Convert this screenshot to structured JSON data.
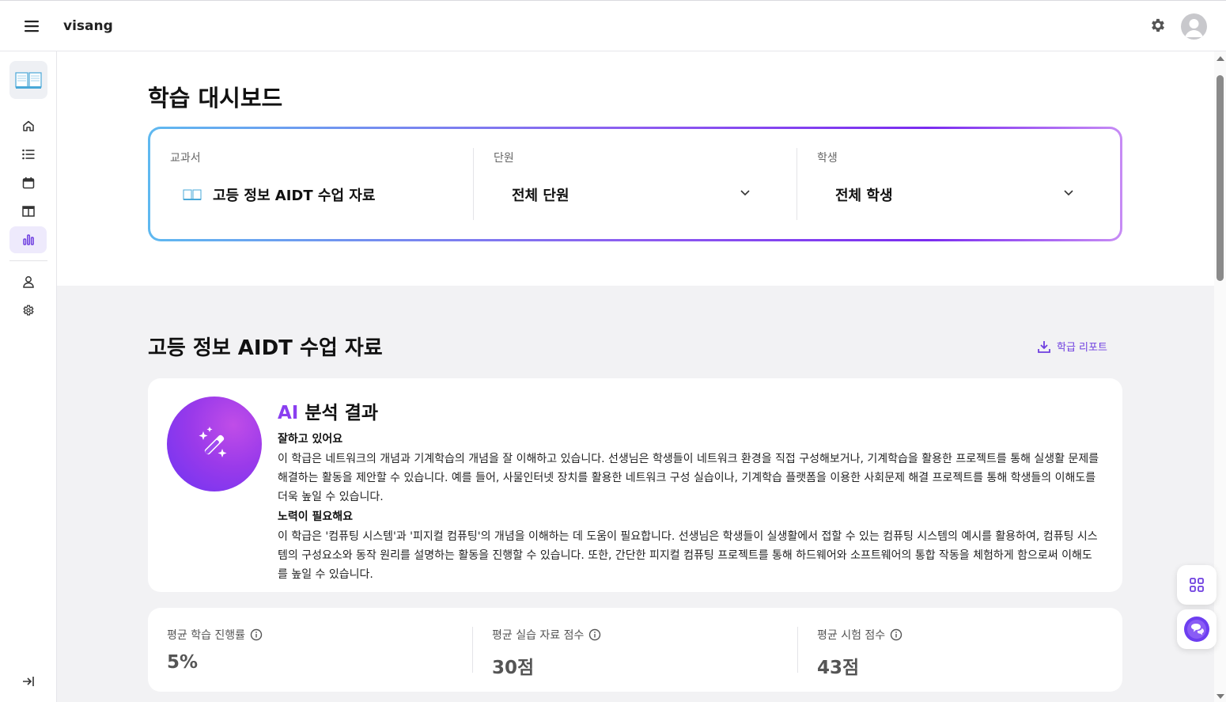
{
  "app": {
    "brand": "visang"
  },
  "sidebar": {
    "items": [
      {
        "name": "home-icon"
      },
      {
        "name": "list-icon"
      },
      {
        "name": "calendar-icon"
      },
      {
        "name": "layout-icon"
      },
      {
        "name": "chart-icon",
        "active": true
      },
      {
        "name": "user-icon"
      },
      {
        "name": "settings-icon"
      }
    ],
    "collapse_icon": "collapse-icon"
  },
  "page": {
    "title": "학습 대시보드"
  },
  "filters": {
    "textbook": {
      "label": "교과서",
      "value": "고등 정보 AIDT 수업 자료"
    },
    "unit": {
      "label": "단원",
      "value": "전체 단원"
    },
    "student": {
      "label": "학생",
      "value": "전체 학생"
    }
  },
  "section": {
    "title": "고등 정보 AIDT 수업 자료",
    "report_label": "학급 리포트"
  },
  "ai": {
    "title_prefix": "AI",
    "title_rest": " 분석 결과",
    "good_heading": "잘하고 있어요",
    "good_text": "이 학급은 네트워크의 개념과 기계학습의 개념을 잘 이해하고 있습니다. 선생님은 학생들이 네트워크 환경을 직접 구성해보거나, 기계학습을 활용한 프로젝트를 통해 실생활 문제를 해결하는 활동을 제안할 수 있습니다. 예를 들어, 사물인터넷 장치를 활용한 네트워크 구성 실습이나, 기계학습 플랫폼을 이용한 사회문제 해결 프로젝트를 통해 학생들의 이해도를 더욱 높일 수 있습니다.",
    "effort_heading": "노력이 필요해요",
    "effort_text": "이 학급은 '컴퓨팅 시스템'과 '피지컬 컴퓨팅'의 개념을 이해하는 데 도움이 필요합니다. 선생님은 학생들이 실생활에서 접할 수 있는 컴퓨팅 시스템의 예시를 활용하여, 컴퓨팅 시스템의 구성요소와 동작 원리를 설명하는 활동을 진행할 수 있습니다. 또한, 간단한 피지컬 컴퓨팅 프로젝트를 통해 하드웨어와 소프트웨어의 통합 작동을 체험하게 함으로써 이해도를 높일 수 있습니다."
  },
  "stats": [
    {
      "label": "평균 학습 진행률",
      "value": "5%"
    },
    {
      "label": "평균 실습 자료 점수",
      "value": "30점"
    },
    {
      "label": "평균 시험 점수",
      "value": "43점"
    }
  ],
  "colors": {
    "accent": "#7a3ff0",
    "active_bg": "#eeeafc",
    "gray_bg": "#f2f2f4"
  }
}
